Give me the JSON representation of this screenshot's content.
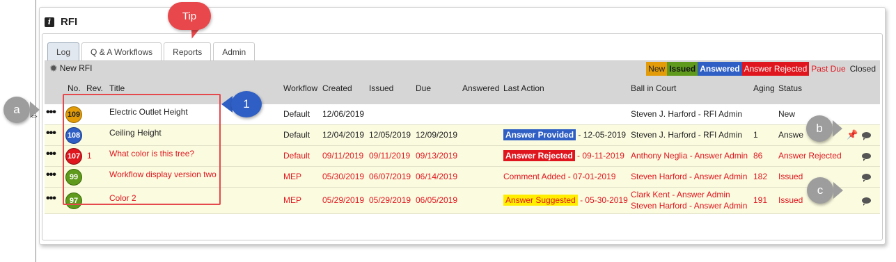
{
  "header": {
    "title": "RFI"
  },
  "tabs": [
    "Log",
    "Q & A Workflows",
    "Reports",
    "Admin"
  ],
  "toolbar": {
    "new_rfi": "New RFI"
  },
  "legend": {
    "new": "New",
    "issued": "Issued",
    "answered": "Answered",
    "answer_rejected": "Answer Rejected",
    "past_due": "Past Due",
    "closed": "Closed"
  },
  "columns": {
    "no": "No.",
    "rev": "Rev.",
    "title": "Title",
    "workflow": "Workflow",
    "created": "Created",
    "issued": "Issued",
    "due": "Due",
    "answered": "Answered",
    "last_action": "Last Action",
    "ball_in_court": "Ball in Court",
    "aging": "Aging",
    "status": "Status"
  },
  "rows": [
    {
      "no": "109",
      "rev": "",
      "title": "Electric Outlet Height",
      "workflow": "Default",
      "created": "12/06/2019",
      "issued": "",
      "due": "",
      "answered": "",
      "last_action_badge": "",
      "last_action_text": "",
      "ball_in_court": "Steven J. Harford - RFI Admin",
      "ball_in_court_2": "",
      "aging": "",
      "status": "New"
    },
    {
      "no": "108",
      "rev": "",
      "title": "Ceiling Height",
      "workflow": "Default",
      "created": "12/04/2019",
      "issued": "12/05/2019",
      "due": "12/09/2019",
      "answered": "",
      "last_action_badge": "Answer Provided",
      "last_action_text": "- 12-05-2019",
      "ball_in_court": "Steven J. Harford - RFI Admin",
      "ball_in_court_2": "",
      "aging": "1",
      "status": "Answe"
    },
    {
      "no": "107",
      "rev": "1",
      "title": "What color is this tree?",
      "workflow": "Default",
      "created": "09/11/2019",
      "issued": "09/11/2019",
      "due": "09/13/2019",
      "answered": "",
      "last_action_badge": "Answer Rejected",
      "last_action_text": "- 09-11-2019",
      "ball_in_court": "Anthony Neglia - Answer Admin",
      "ball_in_court_2": "",
      "aging": "86",
      "status": "Answer Rejected"
    },
    {
      "no": "99",
      "rev": "",
      "title": "Workflow display version two",
      "workflow": "MEP",
      "created": "05/30/2019",
      "issued": "06/07/2019",
      "due": "06/14/2019",
      "answered": "",
      "last_action_badge": "",
      "last_action_text": "Comment Added - 07-01-2019",
      "ball_in_court": "Steven Harford - Answer Admin",
      "ball_in_court_2": "",
      "aging": "182",
      "status": "Issued"
    },
    {
      "no": "97",
      "rev": "",
      "title": "Color 2",
      "workflow": "MEP",
      "created": "05/29/2019",
      "issued": "05/29/2019",
      "due": "06/05/2019",
      "answered": "",
      "last_action_badge": "Answer Suggested",
      "last_action_text": "- 05-30-2019",
      "ball_in_court": "Clark Kent - Answer Admin",
      "ball_in_court_2": "Steven Harford - Answer Admin",
      "aging": "191",
      "status": "Issued"
    }
  ],
  "annotations": {
    "tip": "Tip",
    "one": "1",
    "a": "a",
    "b": "b",
    "c": "c"
  },
  "icons": [
    "info-icon",
    "gear-icon",
    "more-actions-icon",
    "pin-icon",
    "comment-icon",
    "cursor-icon"
  ],
  "colors": {
    "new": "#e39c08",
    "issued": "#5f9a1c",
    "answered": "#2f5fc4",
    "rejected": "#e0161e",
    "callout_blue": "#2f5fc4",
    "callout_gray": "#9d9d9d",
    "tip_red": "#e8484b"
  }
}
